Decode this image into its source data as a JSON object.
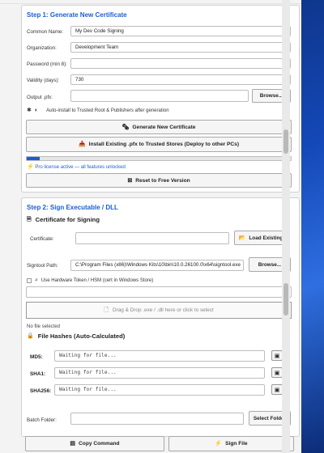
{
  "step1": {
    "title": "Step 1: Generate New Certificate",
    "common_name": {
      "label": "Common Name:",
      "value": "My Dev Code Signing"
    },
    "organization": {
      "label": "Organization:",
      "value": "Development Team"
    },
    "password": {
      "label": "Password (min 8):",
      "value": ""
    },
    "validity": {
      "label": "Validity (days):",
      "value": "730"
    },
    "output": {
      "label": "Output .pfx:",
      "value": "",
      "browse": "Browse..."
    },
    "auto_install": {
      "text": "Auto-install to Trusted Root & Publishers after generation"
    },
    "generate_btn": "Generate New Certificate",
    "install_btn": "Install Existing .pfx to Trusted Stores (Deploy to other PCs)",
    "progress_fraction": 0.05,
    "license_text": "Pro license active — all features unlocked",
    "reset_btn": "Reset to Free Version"
  },
  "step2": {
    "title": "Step 2: Sign Executable / DLL",
    "cert_section": "Certificate for Signing",
    "certificate": {
      "label": "Certificate:",
      "value": "",
      "load": "Load Existing"
    },
    "signtool": {
      "label": "Signtool Path:",
      "value": "C:\\Program Files (x86)\\Windows Kits\\10\\bin\\10.0.26100.0\\x64\\signtool.exe",
      "browse": "Browse..."
    },
    "hardware_token": "Use Hardware Token / HSM (cert in Windows Store)",
    "token_value": "",
    "drop_text": "Drag & Drop .exe / .dll here or click to select",
    "no_file": "No file selected",
    "hashes_title": "File Hashes (Auto-Calculated)",
    "hashes": [
      {
        "label": "MD5:",
        "value": "Waiting for file..."
      },
      {
        "label": "SHA1:",
        "value": "Waiting for file..."
      },
      {
        "label": "SHA256:",
        "value": "Waiting for file..."
      }
    ],
    "batch": {
      "label": "Batch Folder:",
      "value": "",
      "select": "Select Folder"
    },
    "copy_cmd": "Copy Command",
    "sign_file": "Sign File"
  },
  "colors": {
    "accent": "#1a5fd0"
  },
  "icons": [
    "certificate-icon",
    "install-icon",
    "reset-icon",
    "folder-icon",
    "file-icon",
    "hash-icon",
    "copy-icon",
    "lightning-icon",
    "star-icon",
    "gear-icon"
  ]
}
